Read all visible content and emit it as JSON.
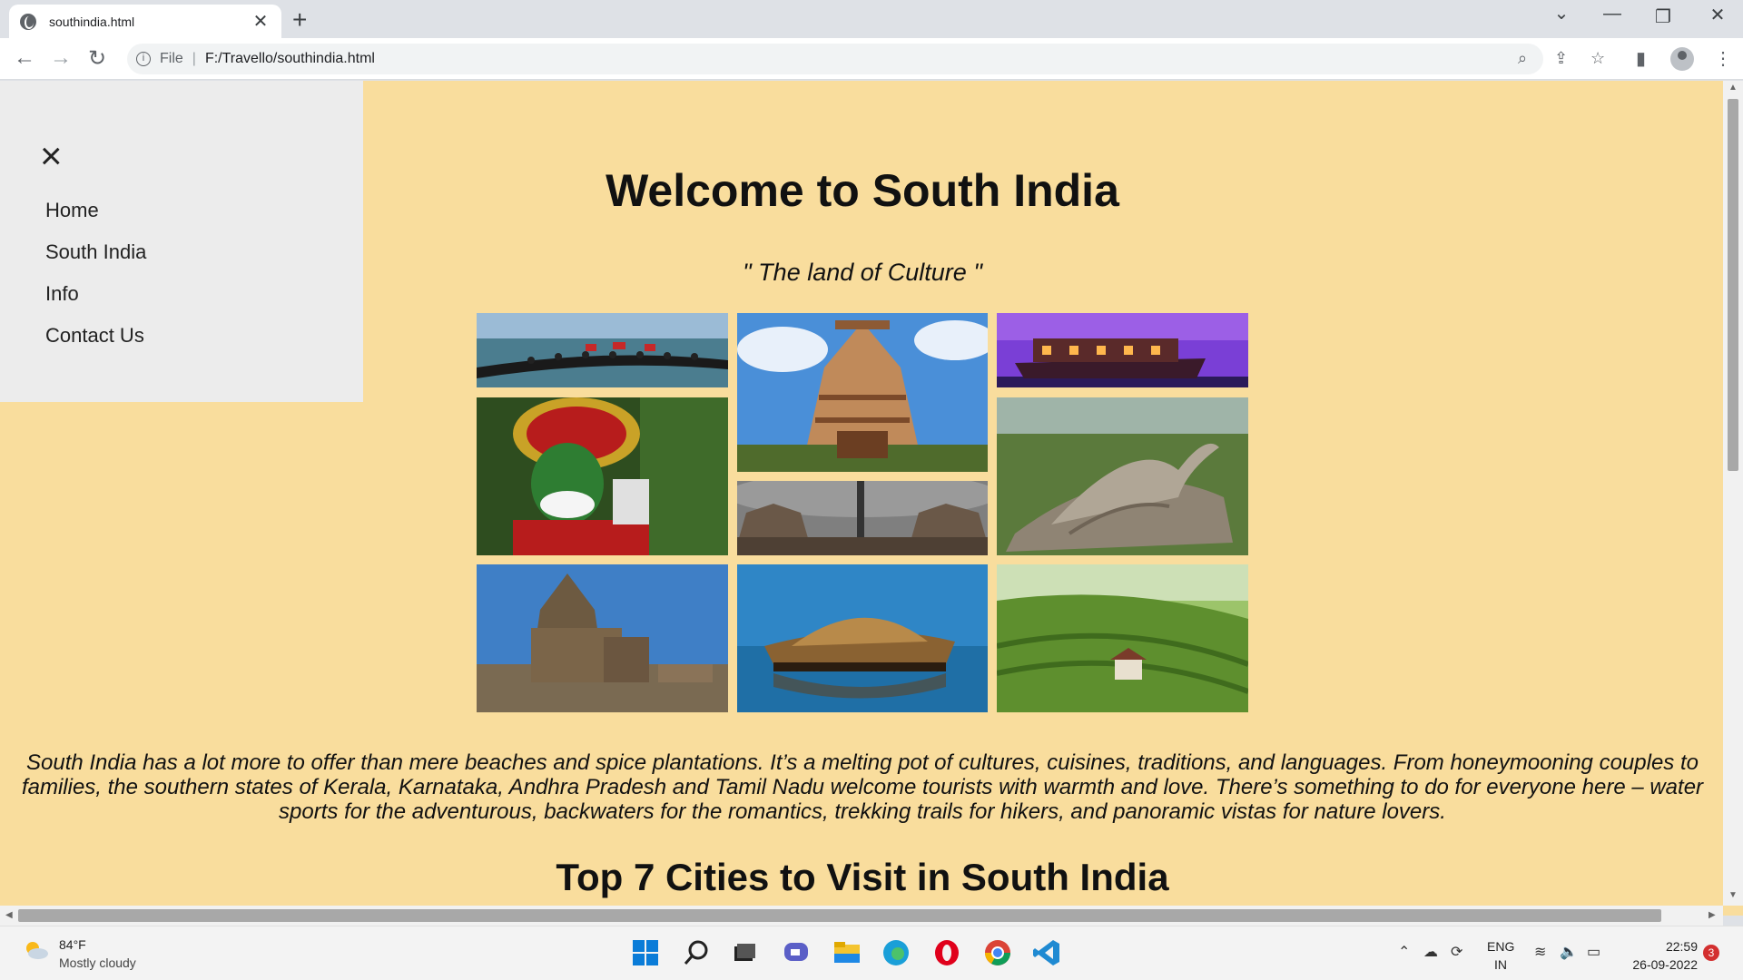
{
  "browser": {
    "tab_title": "southindia.html",
    "tab_close": "✕",
    "new_tab": "+",
    "url_scheme": "File",
    "url_separator": "|",
    "url": "F:/Travello/southindia.html",
    "icons": [
      "back-icon",
      "forward-icon",
      "reload-icon",
      "info-icon",
      "zoom-icon",
      "share-icon",
      "star-icon",
      "side-panel-icon",
      "profile-icon",
      "menu-icon"
    ]
  },
  "sidenav": {
    "close": "×",
    "items": [
      {
        "label": "Home"
      },
      {
        "label": "South India"
      },
      {
        "label": "Info"
      },
      {
        "label": "Contact Us"
      }
    ]
  },
  "page": {
    "title": "Welcome to South India",
    "subtitle": "\" The land of Culture \"",
    "paragraph": "South India has a lot more to offer than mere beaches and spice plantations. It’s a melting pot of cultures, cuisines, traditions, and languages. From honeymooning couples to families, the southern states of Kerala, Karnataka, Andhra Pradesh and Tamil Nadu welcome tourists with warmth and love. There’s something to do for everyone here – water sports for the adventurous, backwaters for the romantics, trekking trails for hikers, and panoramic vistas for nature lovers.",
    "section_heading": "Top 7 Cities to Visit in South India",
    "gallery": [
      "snake-boat-race",
      "temple-gopuram",
      "houseboat-dusk",
      "kathakali-dancer",
      "temple-ruins",
      "bird-sculpture",
      "shore-temple",
      "houseboat-backwaters",
      "tea-plantation"
    ]
  },
  "taskbar": {
    "temperature": "84°F",
    "weather": "Mostly cloudy",
    "lang_line1": "ENG",
    "lang_line2": "IN",
    "time": "22:59",
    "date": "26-09-2022",
    "notifications": "3"
  },
  "colors": {
    "page_background": "#f9dd9d",
    "sidenav_background": "#ececec"
  }
}
